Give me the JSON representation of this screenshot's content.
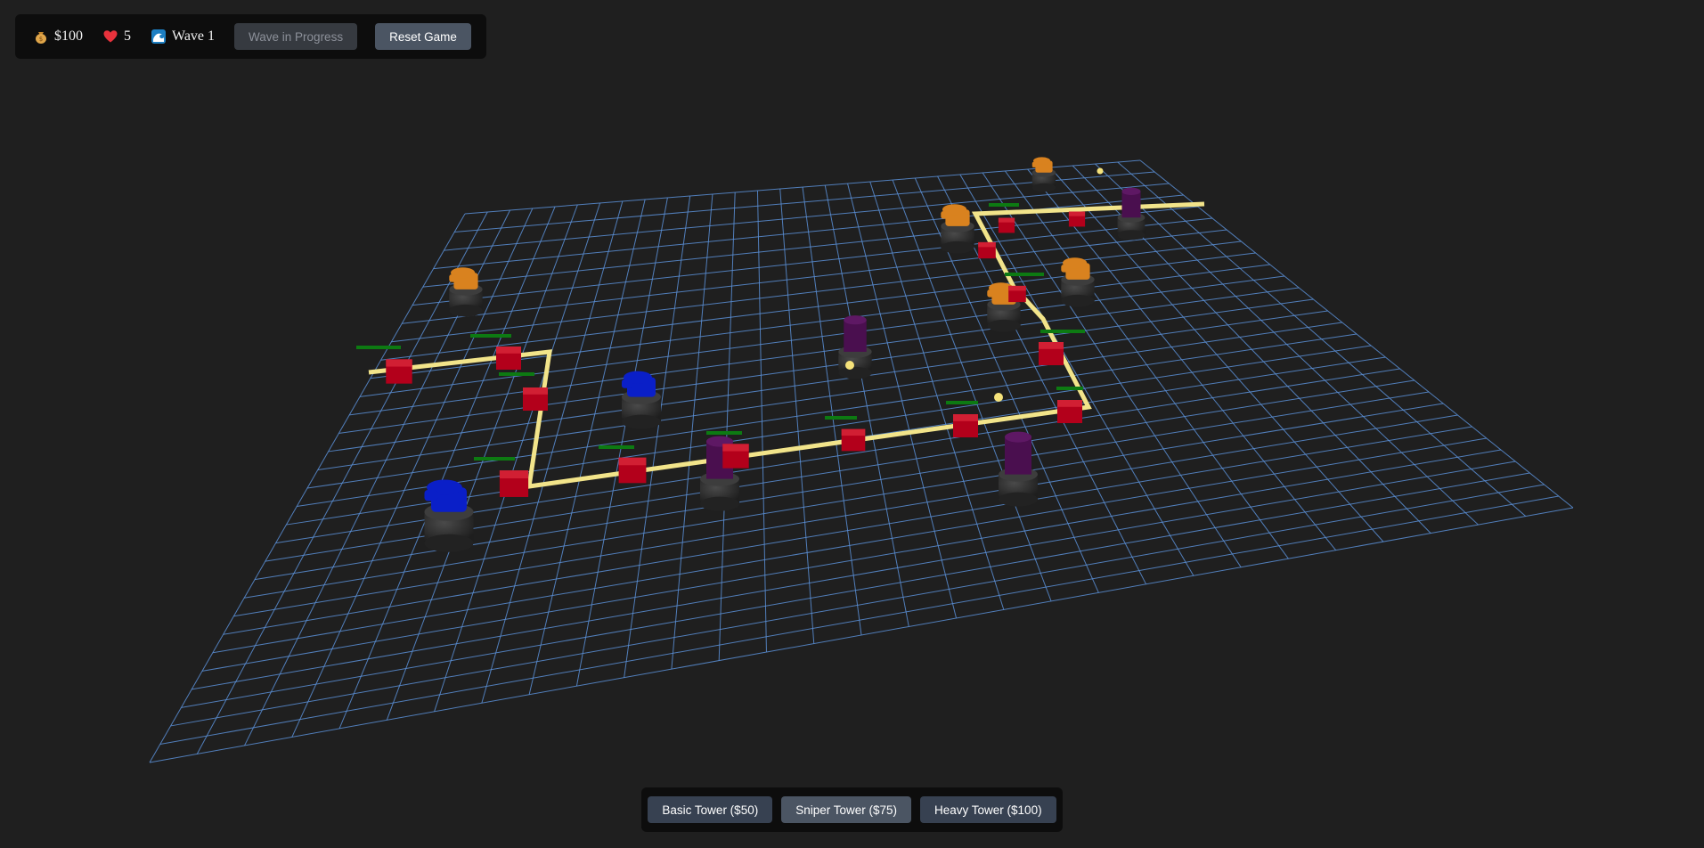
{
  "hud": {
    "money": "$100",
    "lives": "5",
    "wave": "Wave 1",
    "wave_button": "Wave in Progress",
    "reset_button": "Reset Game"
  },
  "toolbar": {
    "basic_tower": "Basic Tower ($50)",
    "sniper_tower": "Sniper Tower ($75)",
    "heavy_tower": "Heavy Tower ($100)",
    "selected": "sniper"
  },
  "icons": {
    "money": "money-bag-icon",
    "lives": "heart-icon",
    "wave": "wave-icon"
  },
  "colors": {
    "background": "#1f1f1f",
    "grid": "#5a8fd6",
    "path": "#f2e48a",
    "enemy": "#b3001b",
    "health_bar": "#0d7a12",
    "basic_tower": "#d9821f",
    "sniper_tower": "#0a1fc8",
    "heavy_tower": "#4a0f4f",
    "tower_base": "#2e2e2e",
    "projectile": "#f5e27a"
  }
}
